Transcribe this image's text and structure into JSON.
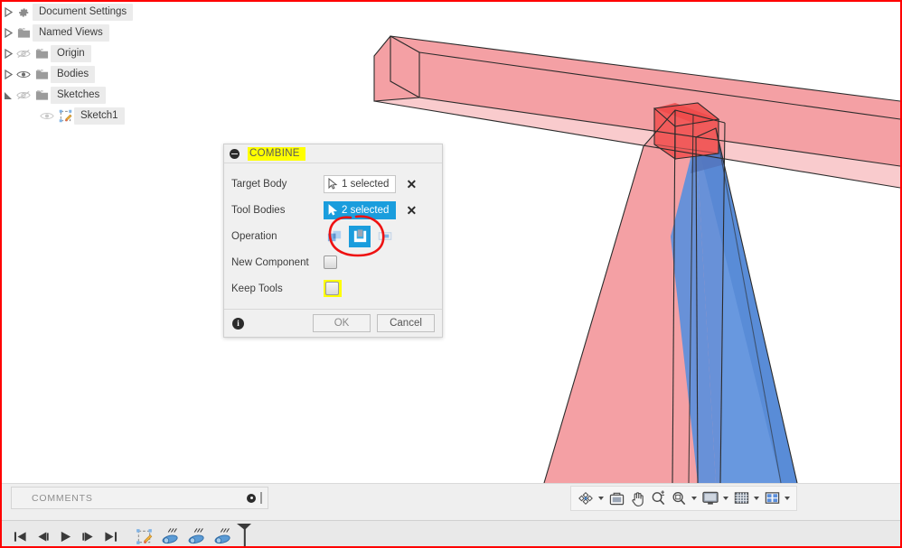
{
  "app": {
    "name": "Fusion 360 CAD viewport",
    "border_color": "#ff0000"
  },
  "browser_tree": {
    "items": [
      {
        "label": "Document Settings",
        "icon": "gear-icon",
        "expander": "collapsed-triangle",
        "eye": "none",
        "indent": 0
      },
      {
        "label": "Named Views",
        "icon": "folder-icon",
        "expander": "collapsed-triangle",
        "eye": "none",
        "indent": 0
      },
      {
        "label": "Origin",
        "icon": "folder-icon",
        "expander": "collapsed-triangle",
        "eye": "eye-hidden-icon",
        "indent": 0
      },
      {
        "label": "Bodies",
        "icon": "folder-icon",
        "expander": "collapsed-triangle",
        "eye": "eye-visible-icon",
        "indent": 0
      },
      {
        "label": "Sketches",
        "icon": "folder-icon",
        "expander": "expanded-triangle",
        "eye": "eye-hidden-icon",
        "indent": 0
      },
      {
        "label": "Sketch1",
        "icon": "sketch-icon",
        "expander": "none",
        "eye": "eye-hidden-icon",
        "indent": 1
      }
    ]
  },
  "combine_dialog": {
    "title": "COMBINE",
    "title_highlight_color": "#ffff00",
    "collapse_icon": "minus-circle-icon",
    "rows": [
      {
        "label": "Target Body",
        "control": "selection",
        "value": "1 selected",
        "active": false,
        "clear": "✕"
      },
      {
        "label": "Tool Bodies",
        "control": "selection",
        "value": "2 selected",
        "active": true,
        "clear": "✕"
      },
      {
        "label": "Operation",
        "control": "operation-toggle"
      },
      {
        "label": "New Component",
        "control": "checkbox",
        "checked": false,
        "highlighted": false
      },
      {
        "label": "Keep Tools",
        "control": "checkbox",
        "checked": false,
        "highlighted": true
      }
    ],
    "operations": [
      {
        "name": "join",
        "selected": false
      },
      {
        "name": "cut",
        "selected": true
      },
      {
        "name": "intersect",
        "selected": false
      }
    ],
    "footer": {
      "info_icon": "info-icon",
      "info_glyph": "i",
      "ok_label": "OK",
      "cancel_label": "Cancel"
    },
    "accent_color": "#1a9ddd"
  },
  "annotation": {
    "type": "hand-drawn-circle",
    "color": "#ee1111",
    "target": "operation-cut-button"
  },
  "viewport": {
    "background": "#ffffff",
    "bodies": [
      {
        "name": "horizontal-beam",
        "color": "#f4a0a4",
        "role": "target-body"
      },
      {
        "name": "left-leg",
        "color": "#f4a0a4",
        "role": "tool-body"
      },
      {
        "name": "right-leg",
        "color": "#5b8fdc",
        "role": "tool-body-selected"
      },
      {
        "name": "overlap-region",
        "color": "#f15b5b",
        "role": "intersection-highlight"
      }
    ],
    "edge_color": "#2b2b2b"
  },
  "nav_toolbar": {
    "items": [
      {
        "name": "orbit-icon",
        "has_caret": true
      },
      {
        "name": "look-at-icon",
        "has_caret": false
      },
      {
        "name": "pan-icon",
        "has_caret": false
      },
      {
        "name": "zoom-icon",
        "has_caret": false
      },
      {
        "name": "fit-icon",
        "has_caret": true
      },
      {
        "name": "display-settings-icon",
        "has_caret": true
      },
      {
        "name": "grid-snaps-icon",
        "has_caret": true
      },
      {
        "name": "viewports-icon",
        "has_caret": true
      }
    ]
  },
  "comments_bar": {
    "label": "COMMENTS",
    "add_icon": "add-comment-icon",
    "grip_icon": "resize-grip-icon"
  },
  "timeline": {
    "playback_buttons": [
      {
        "name": "go-to-beginning-icon"
      },
      {
        "name": "step-back-icon"
      },
      {
        "name": "play-icon"
      },
      {
        "name": "step-forward-icon"
      },
      {
        "name": "go-to-end-icon"
      }
    ],
    "features": [
      {
        "name": "sketch-feature",
        "icon": "sketch-icon"
      },
      {
        "name": "extrude-feature-1",
        "icon": "extrude-icon"
      },
      {
        "name": "extrude-feature-2",
        "icon": "extrude-icon"
      },
      {
        "name": "extrude-feature-3",
        "icon": "extrude-icon"
      }
    ],
    "marker": {
      "name": "timeline-end-marker"
    }
  }
}
